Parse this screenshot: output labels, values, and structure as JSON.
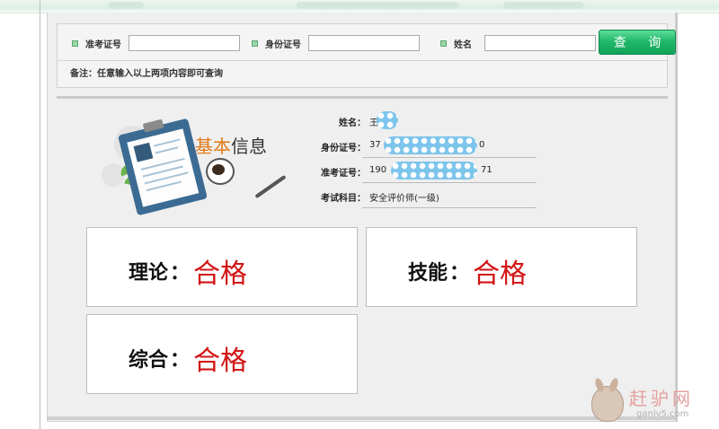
{
  "query": {
    "fields": [
      {
        "label": "准考证号",
        "value": "",
        "placeholder": ""
      },
      {
        "label": "身份证号",
        "value": "",
        "placeholder": ""
      },
      {
        "label": "姓名",
        "value": "",
        "placeholder": ""
      }
    ],
    "button_label": "查 询",
    "note": "备注：任意输入以上两项内容即可查询"
  },
  "illustration": {
    "title_accent": "基本",
    "title_rest": "信息"
  },
  "info": {
    "rows": [
      {
        "label": "姓名：",
        "value_start": "王",
        "value_end": ""
      },
      {
        "label": "身份证号：",
        "value_start": "37",
        "value_end": "0"
      },
      {
        "label": "准考证号：",
        "value_start": "190",
        "value_end": "71"
      },
      {
        "label": "考试科目：",
        "value_start": "安全评价师(一级)",
        "value_end": ""
      }
    ],
    "redaction_color": "#7ec5ec"
  },
  "results": [
    {
      "label": "理论",
      "colon": "：",
      "value": "合格"
    },
    {
      "label": "技能",
      "colon": "：",
      "value": "合格"
    },
    {
      "label": "综合",
      "colon": "：",
      "value": "合格"
    }
  ],
  "colors": {
    "pass": "#d21414",
    "button_green": "#22b96a",
    "accent_orange": "#e07a15"
  },
  "watermark": {
    "text": "赶驴网",
    "url": "ganlv5.com"
  }
}
